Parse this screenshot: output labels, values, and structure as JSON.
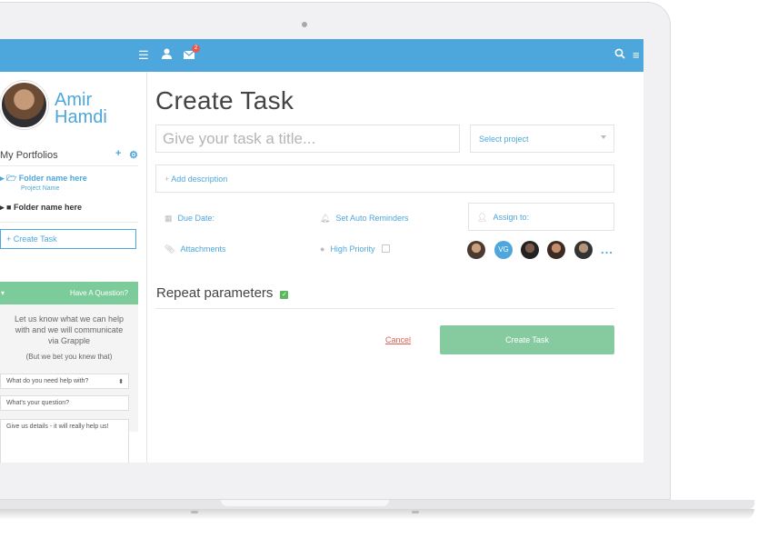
{
  "topbar": {
    "icons": [
      "list-icon",
      "user-icon",
      "mail-icon",
      "search-icon",
      "menu-icon"
    ],
    "mail_badge": "2",
    "accent": "#4ea7dc"
  },
  "sidebar": {
    "user_first": "Amir",
    "user_last": "Hamdi",
    "portfolios_heading": "My Portfolios",
    "folders": [
      {
        "name": "Folder name here",
        "project": "Project Name",
        "expanded": true
      },
      {
        "name": "Folder name here",
        "expanded": false
      }
    ],
    "create_task_label": "Create Task",
    "question": {
      "heading": "Have A Question?",
      "line1": "Let us know what we can help",
      "line2": "with and we will communicate",
      "line3": "via Grapple",
      "aside": "(But we bet you knew that)",
      "help_select": "What do you need help with?",
      "question_placeholder": "What's your question?",
      "details_placeholder": "Give us details - it will really help us!"
    }
  },
  "main": {
    "title": "Create Task",
    "title_placeholder": "Give your task a title...",
    "project_select": "Select project",
    "add_description": "Add description",
    "due_date": "Due Date:",
    "reminders": "Set Auto Reminders",
    "assign_to": "Assign to:",
    "attachments": "Attachments",
    "high_priority": "High Priority",
    "assignee_initials": "VG",
    "more": "...",
    "repeat": "Repeat parameters",
    "cancel": "Cancel",
    "create_button": "Create Task",
    "button_color": "#86cba0"
  }
}
